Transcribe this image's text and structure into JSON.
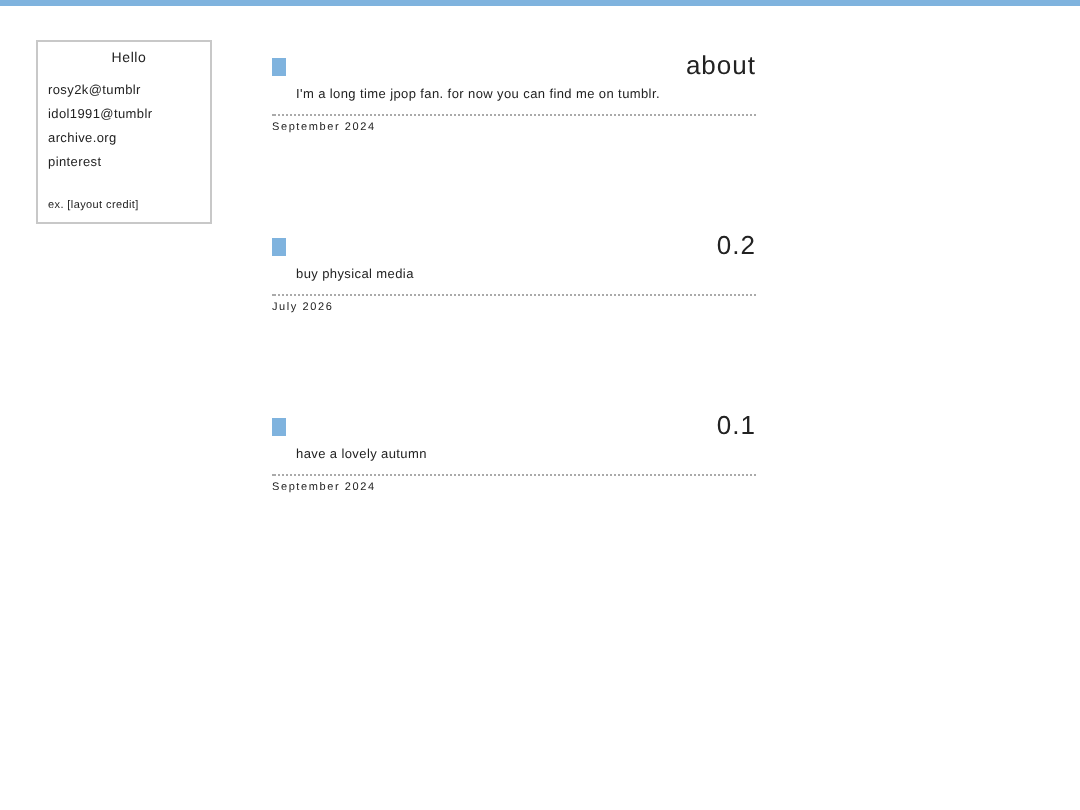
{
  "sidebar": {
    "title": "Hello",
    "links": [
      "rosy2k@tumblr",
      "idol1991@tumblr",
      "archive.org",
      "pinterest"
    ],
    "credit": "ex. [layout credit]"
  },
  "posts": [
    {
      "title": "about",
      "body": "I'm a long time jpop fan. for now you can find me on tumblr.",
      "date": "September 2024"
    },
    {
      "title": "0.2",
      "body": "buy physical media",
      "date": "July 2026"
    },
    {
      "title": "0.1",
      "body": "have a lovely autumn",
      "date": "September 2024"
    }
  ]
}
